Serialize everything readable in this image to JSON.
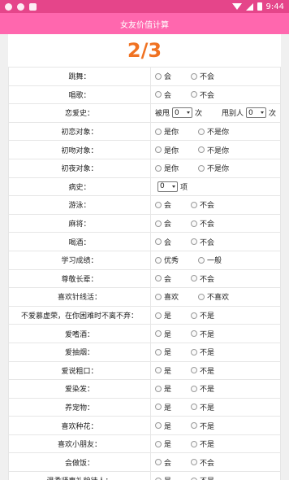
{
  "status_bar": {
    "time": "9:44"
  },
  "header": {
    "title": "女友价值计算"
  },
  "progress": "2/3",
  "rows": [
    {
      "label": "跳舞：",
      "type": "radio",
      "options": [
        "会",
        "不会"
      ]
    },
    {
      "label": "唱歌：",
      "type": "radio",
      "options": [
        "会",
        "不会"
      ]
    },
    {
      "label": "恋爱史：",
      "type": "dual_select",
      "pre1": "被甩",
      "value1": "0",
      "unit1": "次",
      "pre2": "甩别人",
      "value2": "0",
      "unit2": "次"
    },
    {
      "label": "初恋对象：",
      "type": "radio",
      "options": [
        "是你",
        "不是你"
      ]
    },
    {
      "label": "初吻对象：",
      "type": "radio",
      "options": [
        "是你",
        "不是你"
      ]
    },
    {
      "label": "初夜对象：",
      "type": "radio",
      "options": [
        "是你",
        "不是你"
      ]
    },
    {
      "label": "病史：",
      "type": "select",
      "value": "0",
      "unit": "项"
    },
    {
      "label": "游泳：",
      "type": "radio",
      "options": [
        "会",
        "不会"
      ]
    },
    {
      "label": "麻将：",
      "type": "radio",
      "options": [
        "会",
        "不会"
      ]
    },
    {
      "label": "喝酒：",
      "type": "radio",
      "options": [
        "会",
        "不会"
      ]
    },
    {
      "label": "学习成绩：",
      "type": "radio",
      "options": [
        "优秀",
        "一般"
      ]
    },
    {
      "label": "尊敬长辈：",
      "type": "radio",
      "options": [
        "会",
        "不会"
      ]
    },
    {
      "label": "喜欢针线活：",
      "type": "radio",
      "options": [
        "喜欢",
        "不喜欢"
      ]
    },
    {
      "label": "不爱慕虚荣，在你困难时不离不弃：",
      "type": "radio",
      "options": [
        "是",
        "不是"
      ]
    },
    {
      "label": "爱嗜酒：",
      "type": "radio",
      "options": [
        "是",
        "不是"
      ]
    },
    {
      "label": "爱抽烟：",
      "type": "radio",
      "options": [
        "是",
        "不是"
      ]
    },
    {
      "label": "爱说粗口：",
      "type": "radio",
      "options": [
        "是",
        "不是"
      ]
    },
    {
      "label": "爱染发：",
      "type": "radio",
      "options": [
        "是",
        "不是"
      ]
    },
    {
      "label": "养宠物：",
      "type": "radio",
      "options": [
        "是",
        "不是"
      ]
    },
    {
      "label": "喜欢种花：",
      "type": "radio",
      "options": [
        "是",
        "不是"
      ]
    },
    {
      "label": "喜欢小朋友：",
      "type": "radio",
      "options": [
        "是",
        "不是"
      ]
    },
    {
      "label": "会做饭：",
      "type": "radio",
      "options": [
        "会",
        "不会"
      ]
    },
    {
      "label": "温柔贤惠礼貌待人：",
      "type": "radio",
      "options": [
        "是",
        "不是"
      ]
    }
  ]
}
